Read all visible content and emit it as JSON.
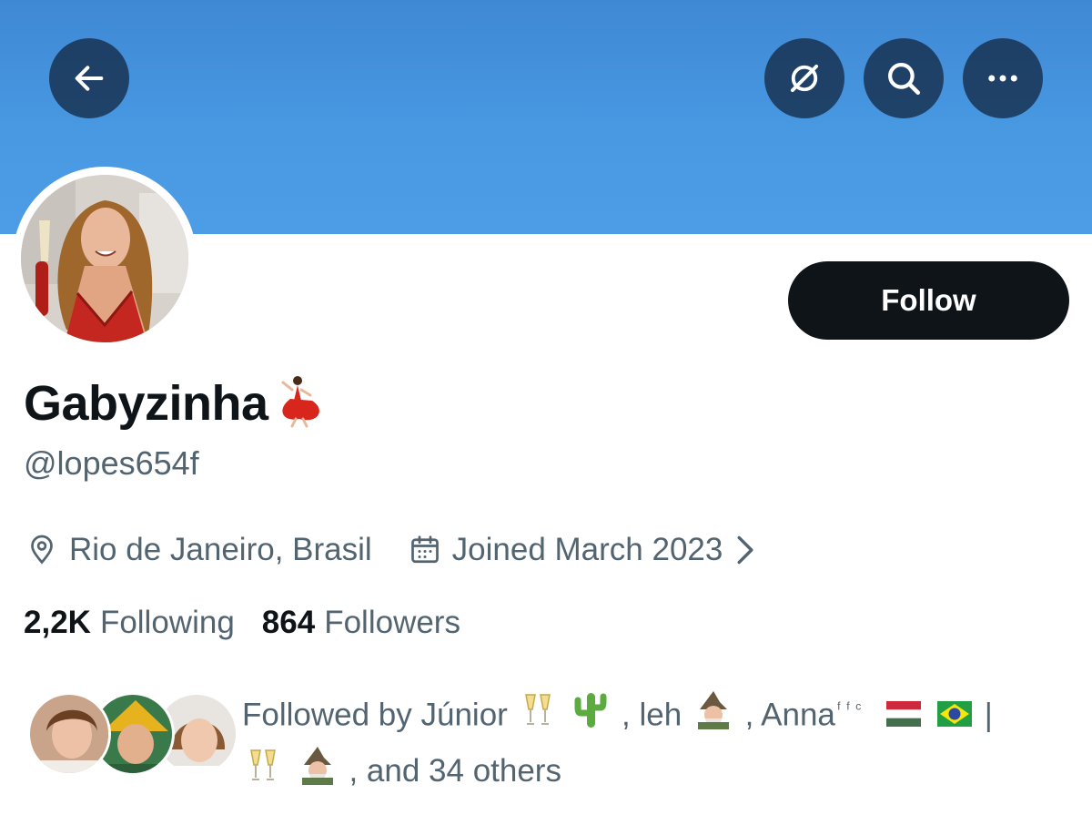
{
  "header": {
    "back_icon": "arrow-left-icon",
    "translate_icon": "translate-icon",
    "search_icon": "search-icon",
    "more_icon": "more-horizontal-icon",
    "banner_color": "#4898e2"
  },
  "profile": {
    "display_name": "Gabyzinha",
    "name_emoji": "dancer-emoji",
    "handle": "@lopes654f",
    "follow_label": "Follow",
    "location": "Rio de Janeiro, Brasil",
    "joined": "Joined March 2023"
  },
  "stats": {
    "following_count": "2,2K",
    "following_label": "Following",
    "followers_count": "864",
    "followers_label": "Followers"
  },
  "followed_by": {
    "prefix": "Followed by Júnior",
    "sep1": ", leh",
    "sep2": ", Anna",
    "sup": "ᶠᶠᶜ",
    "pipe": "|",
    "suffix": ", and 34 others"
  }
}
